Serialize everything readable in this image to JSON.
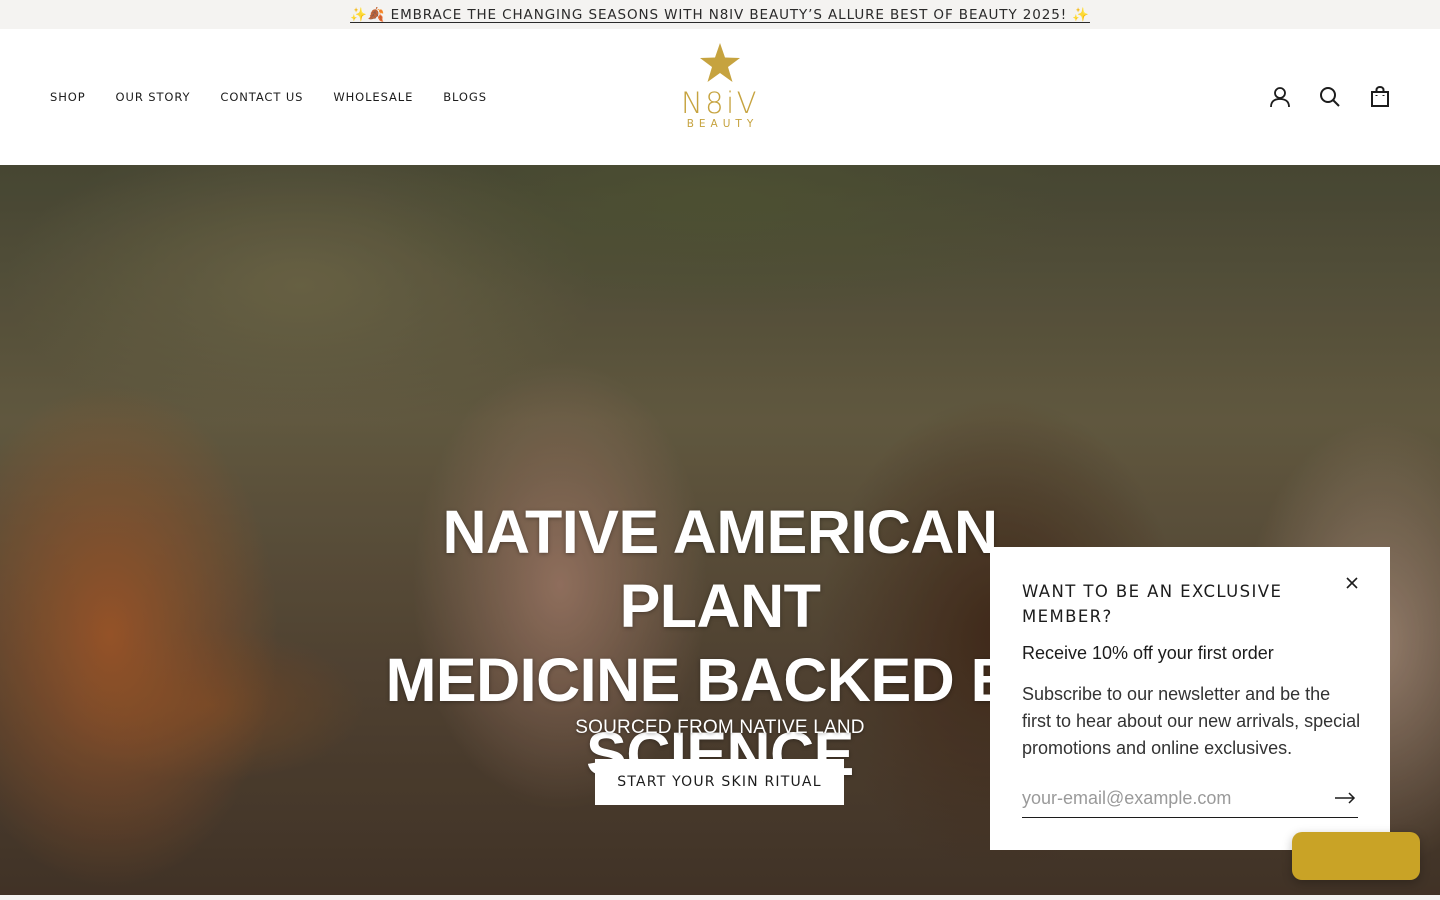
{
  "announcement": {
    "text": "✨🍂 EMBRACE THE CHANGING SEASONS WITH N8IV BEAUTY’S ALLURE BEST OF BEAUTY 2025! ✨"
  },
  "nav": {
    "items": [
      {
        "label": "SHOP"
      },
      {
        "label": "OUR STORY"
      },
      {
        "label": "CONTACT US"
      },
      {
        "label": "WHOLESALE"
      },
      {
        "label": "BLOGS"
      }
    ]
  },
  "logo": {
    "word": "N8iV",
    "sub": "BEAUTY",
    "color": "#c6a33f"
  },
  "header_icons": [
    "account-icon",
    "search-icon",
    "cart-icon"
  ],
  "hero": {
    "headline_lines": [
      "NATIVE AMERICAN PLANT",
      "MEDICINE BACKED BY",
      "SCIENCE"
    ],
    "subheading": "SOURCED FROM NATIVE LAND",
    "cta_label": "START YOUR SKIN RITUAL"
  },
  "popup": {
    "title": "WANT TO BE AN EXCLUSIVE MEMBER?",
    "offer": "Receive 10% off your first order",
    "body": "Subscribe to our newsletter and be the first to hear about our new arrivals, special promotions and online exclusives.",
    "email_placeholder": "your-email@example.com"
  },
  "colors": {
    "accent": "#c9a326",
    "announcement_bg": "#f4f3f1"
  }
}
